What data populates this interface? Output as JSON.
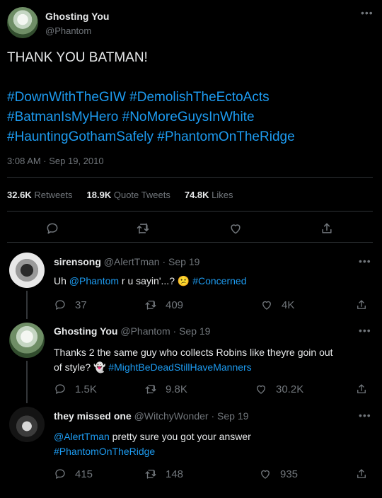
{
  "main_tweet": {
    "display_name": "Ghosting You",
    "handle": "@Phantom",
    "text": "THANK YOU BATMAN!",
    "hashtags": [
      "#DownWithTheGIW",
      "#DemolishTheEctoActs",
      "#BatmanIsMyHero",
      "#NoMoreGuysInWhite",
      "#HauntingGothamSafely",
      "#PhantomOnTheRidge"
    ],
    "timestamp": "3:08 AM · Sep 19, 2010",
    "stats": {
      "retweets_count": "32.6K",
      "retweets_label": "Retweets",
      "quotes_count": "18.9K",
      "quotes_label": "Quote Tweets",
      "likes_count": "74.8K",
      "likes_label": "Likes"
    }
  },
  "replies": [
    {
      "display_name": "sirensong",
      "handle": "@AlertTman",
      "date": "· Sep 19",
      "text_parts": [
        "Uh ",
        "@Phantom",
        " r u sayin'...? ",
        "😕",
        " ",
        "#Concerned"
      ],
      "replies": "37",
      "retweets": "409",
      "likes": "4K"
    },
    {
      "display_name": "Ghosting You",
      "handle": "@Phantom",
      "date": "· Sep 19",
      "text_line1": "Thanks 2 the same guy who collects Robins like theyre goin out",
      "text_line2_a": "of style? ",
      "emoji": "👻",
      "hashtag": "#MightBeDeadStillHaveManners",
      "replies": "1.5K",
      "retweets": "9.8K",
      "likes": "30.2K"
    },
    {
      "display_name": "they missed one",
      "handle": "@WitchyWonder",
      "date": "· Sep 19",
      "mention": "@AlertTman",
      "text_rest": " pretty sure you got your answer",
      "hashtag": "#PhantomOnTheRidge",
      "replies": "415",
      "retweets": "148",
      "likes": "935"
    }
  ],
  "icons": {
    "reply": "reply-icon",
    "retweet": "retweet-icon",
    "like": "heart-icon",
    "share": "share-icon",
    "more": "more-icon"
  },
  "colors": {
    "background": "#000000",
    "text": "#e7e9ea",
    "muted": "#71767b",
    "link": "#1d9bf0",
    "divider": "#2f3336"
  }
}
